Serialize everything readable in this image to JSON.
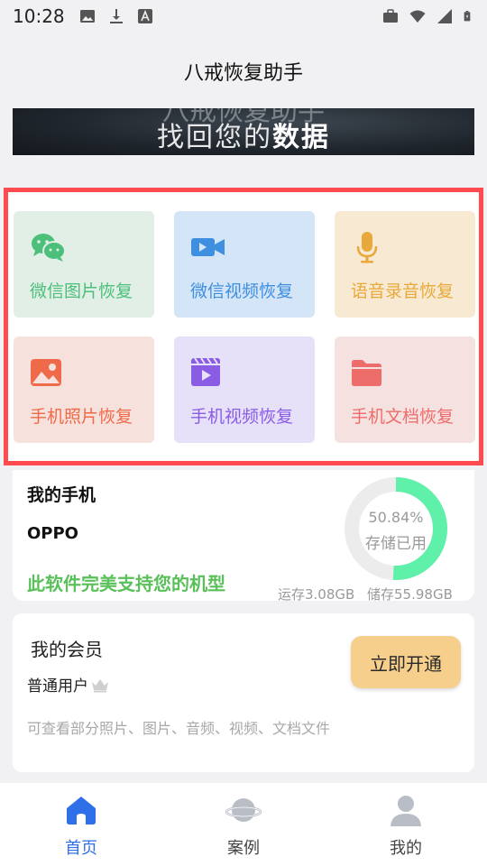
{
  "status_bar": {
    "time": "10:28",
    "left_icons": [
      "image-icon",
      "download-icon",
      "font-icon"
    ],
    "right_icons": [
      "briefcase-icon",
      "wifi-icon",
      "signal-icon",
      "battery-icon"
    ]
  },
  "header": {
    "title": "八戒恢复助手"
  },
  "banner": {
    "ghost_text": "八戒恢复助手",
    "text_plain": "找回您的",
    "text_bold": "数据"
  },
  "features": [
    {
      "label": "微信图片恢复",
      "icon": "wechat-icon",
      "color": "#4cbf7a",
      "bg": "#e1efe6"
    },
    {
      "label": "微信视频恢复",
      "icon": "video-camera-icon",
      "color": "#3f8fe0",
      "bg": "#d4e5f8"
    },
    {
      "label": "语音录音恢复",
      "icon": "microphone-icon",
      "color": "#e9a93a",
      "bg": "#f8e9d2"
    },
    {
      "label": "手机照片恢复",
      "icon": "photo-icon",
      "color": "#ee6a48",
      "bg": "#f7e1dc"
    },
    {
      "label": "手机视频恢复",
      "icon": "film-icon",
      "color": "#8a5ce4",
      "bg": "#e6e0f9"
    },
    {
      "label": "手机文档恢复",
      "icon": "folder-icon",
      "color": "#ec6d6a",
      "bg": "#f6e1e1"
    }
  ],
  "phone_card": {
    "title": "我的手机",
    "brand": "OPPO",
    "support_text": "此软件完美支持您的机型",
    "usage_percent_text": "50.84%",
    "usage_percent": 50.84,
    "usage_label": "存储已用",
    "ram_text": "运存3.08GB",
    "storage_text": "储存55.98GB",
    "donut_color": "#5ff0aa",
    "donut_track_color": "#ececec"
  },
  "member_card": {
    "title": "我的会员",
    "level": "普通用户",
    "level_icon": "crown-icon",
    "description": "可查看部分照片、图片、音频、视频、文档文件",
    "open_button_label": "立即开通"
  },
  "bottom_nav": [
    {
      "label": "首页",
      "icon": "home-icon",
      "active": true
    },
    {
      "label": "案例",
      "icon": "planet-icon",
      "active": false
    },
    {
      "label": "我的",
      "icon": "user-icon",
      "active": false
    }
  ],
  "accent_color": "#2f6fe8"
}
